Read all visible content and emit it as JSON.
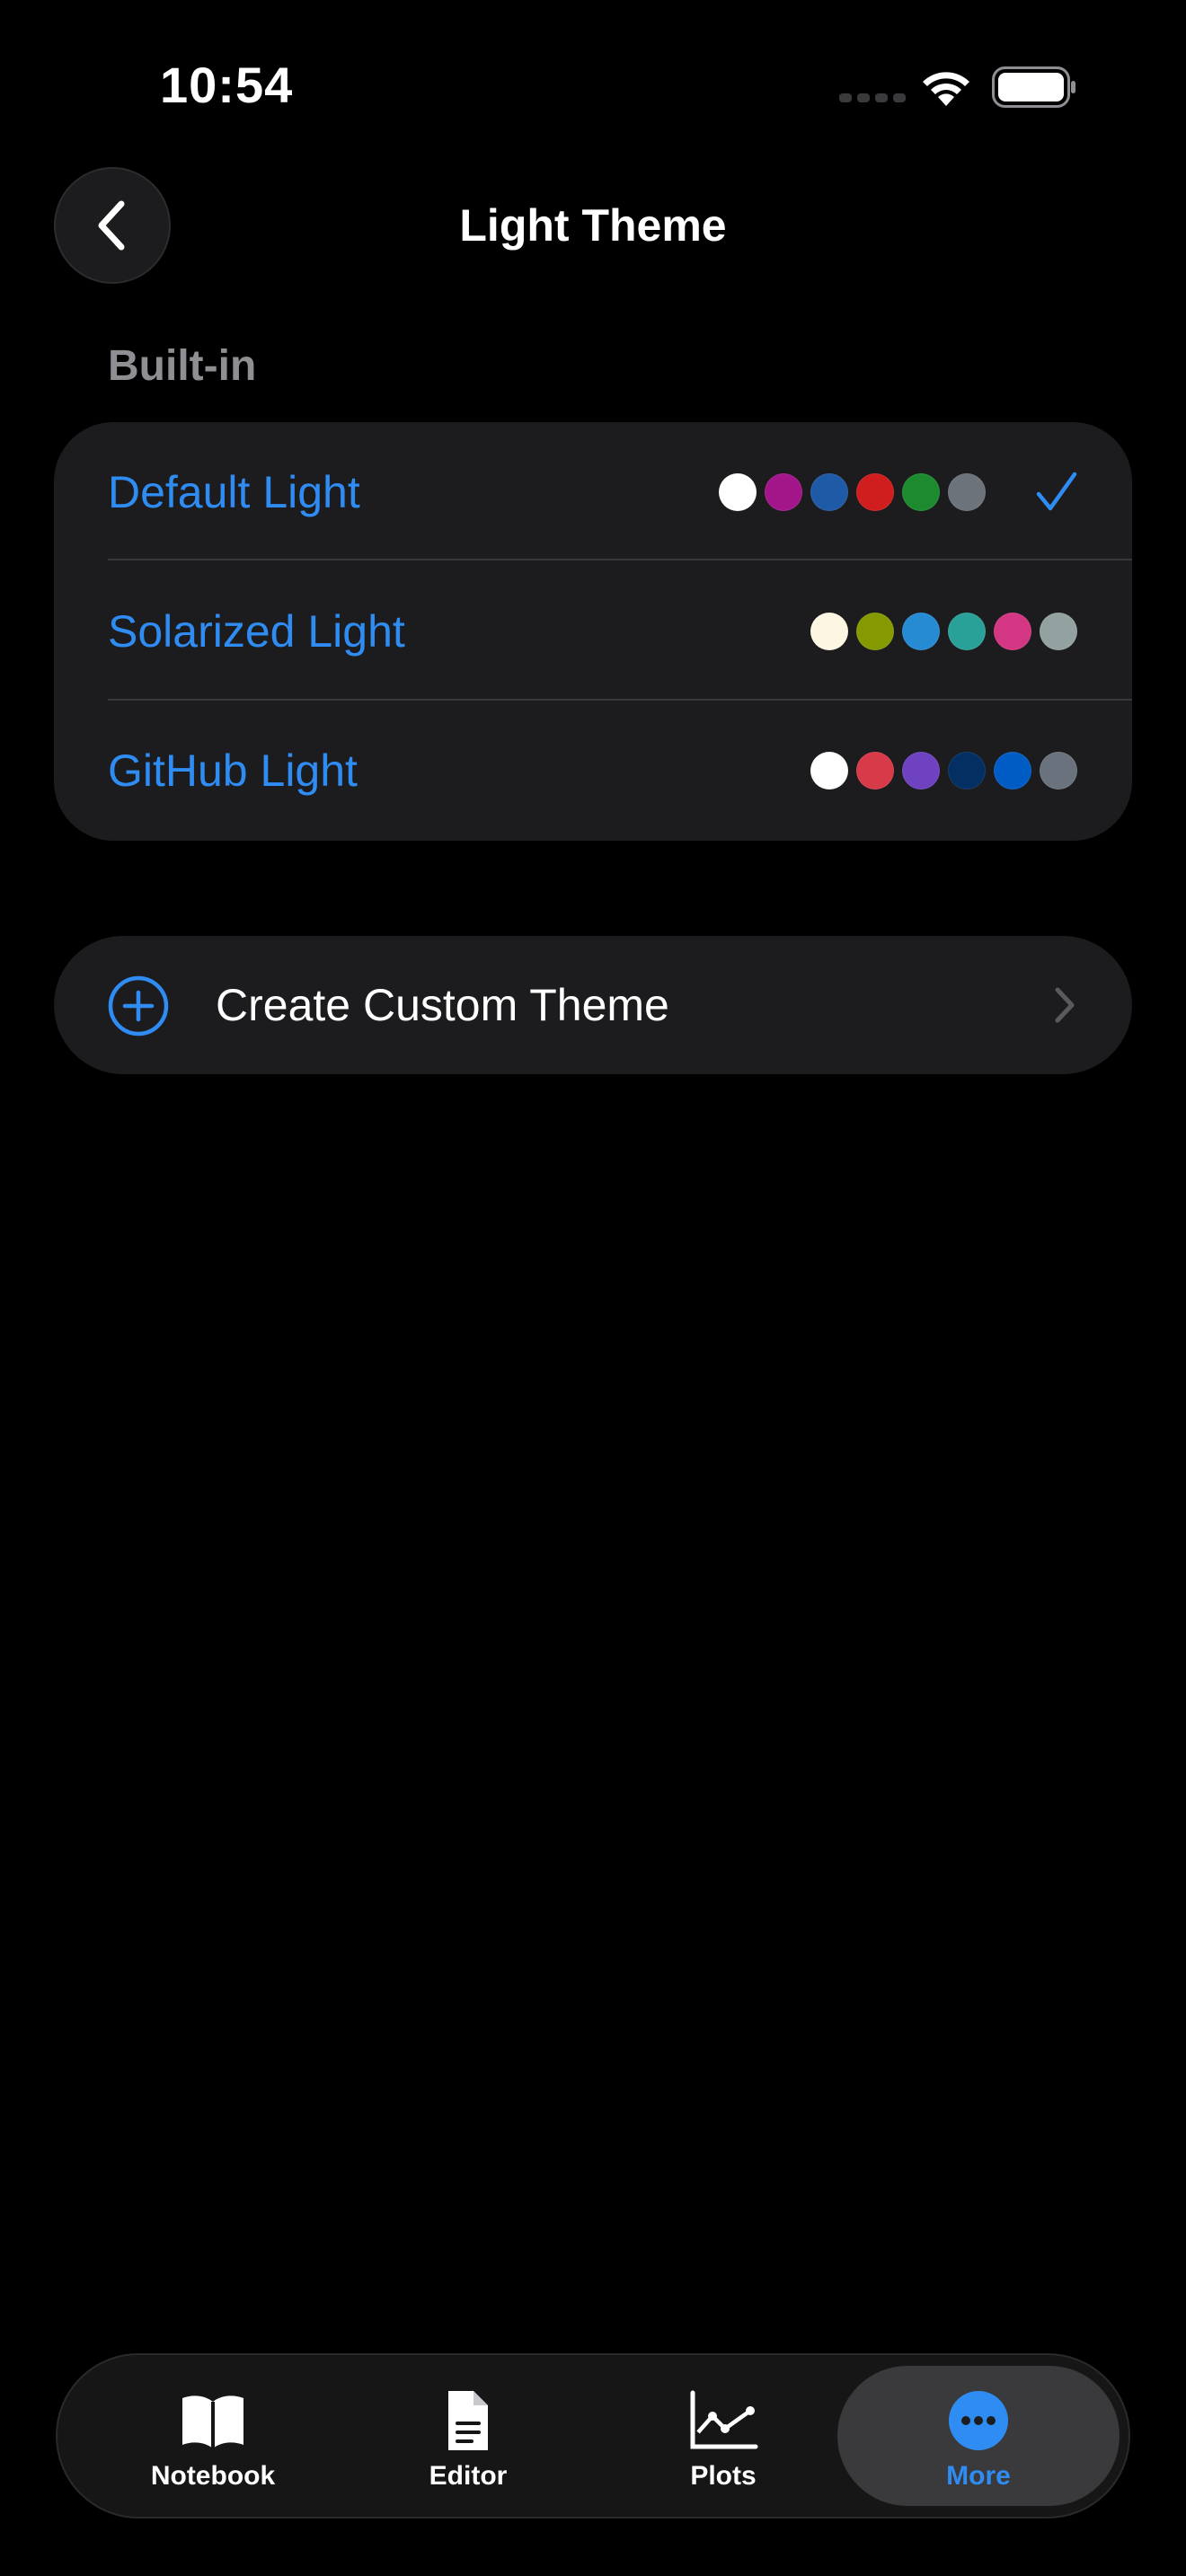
{
  "status_bar": {
    "time": "10:54"
  },
  "nav": {
    "back_icon": "chevron-left-icon",
    "title": "Light Theme"
  },
  "sections": {
    "builtin_header": "Built-in"
  },
  "themes": [
    {
      "label": "Default Light",
      "selected": true,
      "swatches": [
        "#ffffff",
        "#a3168a",
        "#1f5aa6",
        "#d01d1d",
        "#1e8a2f",
        "#6d737b"
      ]
    },
    {
      "label": "Solarized Light",
      "selected": false,
      "swatches": [
        "#fdf6e3",
        "#859900",
        "#268bd2",
        "#2aa198",
        "#d33682",
        "#93a1a1"
      ]
    },
    {
      "label": "GitHub Light",
      "selected": false,
      "swatches": [
        "#ffffff",
        "#d73a49",
        "#6f42c1",
        "#032f62",
        "#005cc5",
        "#6a737d"
      ]
    }
  ],
  "create_custom": {
    "label": "Create Custom Theme",
    "icon": "plus-circle-icon"
  },
  "tab_bar": {
    "tabs": [
      {
        "label": "Notebook",
        "icon": "book-icon",
        "active": false
      },
      {
        "label": "Editor",
        "icon": "document-icon",
        "active": false
      },
      {
        "label": "Plots",
        "icon": "chart-icon",
        "active": false
      },
      {
        "label": "More",
        "icon": "ellipsis-circle-icon",
        "active": true
      }
    ]
  },
  "colors": {
    "accent": "#2f8cf3",
    "background": "#000000",
    "card": "#1c1c1e",
    "secondary_text": "#8e8e93"
  }
}
